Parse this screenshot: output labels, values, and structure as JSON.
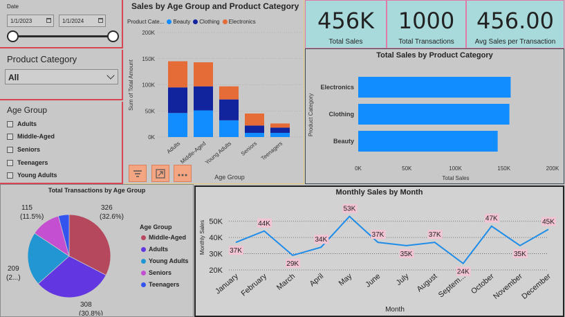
{
  "date_slicer": {
    "label": "Date",
    "start": "1/1/2023",
    "end": "1/1/2024"
  },
  "product_slicer": {
    "title": "Product Category",
    "selected": "All"
  },
  "age_slicer": {
    "title": "Age Group",
    "items": [
      "Adults",
      "Middle-Aged",
      "Seniors",
      "Teenagers",
      "Young Adults"
    ]
  },
  "toolbar": {
    "icons": [
      "filter-icon",
      "focus-mode-icon",
      "more-options-icon"
    ],
    "color": "#f4a582"
  },
  "kpis": {
    "total_sales": {
      "value": "456K",
      "label": "Total Sales"
    },
    "total_transactions": {
      "value": "1000",
      "label": "Total Transactions"
    },
    "avg_sales": {
      "value": "456.00",
      "label": "Avg Sales per Transaction"
    }
  },
  "chart_data": [
    {
      "type": "bar",
      "stacked": true,
      "title": "Sales by Age Group and Product Category",
      "legend_title": "Product Cate...",
      "legend_position": "top-left",
      "xlabel": "Age Group",
      "ylabel": "Sum of Total Amount",
      "ylim": [
        0,
        200000
      ],
      "yticks": [
        "0K",
        "50K",
        "100K",
        "150K",
        "200K"
      ],
      "categories": [
        "Adults",
        "Middle-Aged",
        "Young Adults",
        "Seniors",
        "Teenagers"
      ],
      "series": [
        {
          "name": "Beauty",
          "color": "#118dff",
          "values": [
            46000,
            51000,
            32000,
            8000,
            8000
          ]
        },
        {
          "name": "Clothing",
          "color": "#12239e",
          "values": [
            49000,
            46000,
            40000,
            14000,
            10000
          ]
        },
        {
          "name": "Electronics",
          "color": "#e66c37",
          "values": [
            50000,
            46000,
            25000,
            23000,
            8000
          ]
        }
      ]
    },
    {
      "type": "bar",
      "orientation": "horizontal",
      "title": "Total Sales by Product Category",
      "xlabel": "Total Sales",
      "ylabel": "Product Category",
      "xlim": [
        0,
        200000
      ],
      "xticks": [
        "0K",
        "50K",
        "100K",
        "150K",
        "200K"
      ],
      "categories": [
        "Electronics",
        "Clothing",
        "Beauty"
      ],
      "values": [
        156905,
        155580,
        143515
      ],
      "color": "#118dff"
    },
    {
      "type": "pie",
      "title": "Total Transactions by Age Group",
      "legend_title": "Age Group",
      "legend_position": "right",
      "categories": [
        "Middle-Aged",
        "Adults",
        "Young Adults",
        "Seniors",
        "Teenagers"
      ],
      "values": [
        326,
        308,
        209,
        115,
        42
      ],
      "labels": [
        "326 (32.6%)",
        "308 (30.8%)",
        "209 (2...)",
        "115 (11.5%)",
        ""
      ],
      "colors": [
        "#b5485d",
        "#6236e0",
        "#2196d3",
        "#c44fd0",
        "#3454f0"
      ]
    },
    {
      "type": "line",
      "title": "Monthly Sales by Month",
      "xlabel": "Month",
      "ylabel": "Monthly Sales",
      "ylim": [
        20000,
        55000
      ],
      "yticks": [
        "20K",
        "30K",
        "40K",
        "50K"
      ],
      "categories": [
        "January",
        "February",
        "March",
        "April",
        "May",
        "June",
        "July",
        "August",
        "Septem...",
        "October",
        "November",
        "December"
      ],
      "values": [
        37000,
        44000,
        29000,
        34000,
        53000,
        37000,
        35000,
        37000,
        24000,
        47000,
        35000,
        45000
      ],
      "data_labels": [
        "37K",
        "44K",
        "29K",
        "34K",
        "53K",
        "37K",
        "35K",
        "37K",
        "24K",
        "47K",
        "35K",
        "45K"
      ],
      "color": "#1e8ce8",
      "label_bg": "#f2c4d4"
    }
  ]
}
